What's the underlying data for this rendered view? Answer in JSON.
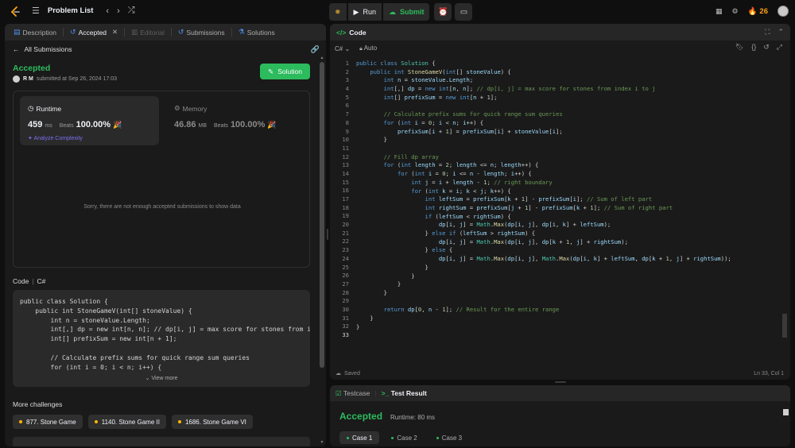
{
  "topbar": {
    "problem_list_label": "Problem List",
    "run_label": "Run",
    "submit_label": "Submit",
    "streak_count": "26"
  },
  "left_tabs": [
    {
      "label": "Description"
    },
    {
      "label": "Accepted"
    },
    {
      "label": "Editorial"
    },
    {
      "label": "Submissions"
    },
    {
      "label": "Solutions"
    }
  ],
  "submission": {
    "back_label": "All Submissions",
    "status": "Accepted",
    "user": "R M",
    "submitted_text": "submitted at Sep 26, 2024 17:03",
    "solution_button": "Solution",
    "runtime": {
      "title": "Runtime",
      "value": "459",
      "unit": "ms",
      "beats_label": "Beats",
      "beats_pct": "100.00%",
      "analyze_label": "Analyze Complexity"
    },
    "memory": {
      "title": "Memory",
      "value": "46.86",
      "unit": "MB",
      "beats_label": "Beats",
      "beats_pct": "100.00%"
    },
    "empty_note": "Sorry, there are not enough accepted submissions to show data",
    "code_label": "Code",
    "code_lang": "C#",
    "code_preview": "public class Solution {\n    public int StoneGameV(int[] stoneValue) {\n        int n = stoneValue.Length;\n        int[,] dp = new int[n, n]; // dp[i, j] = max score for stones from i\n        int[] prefixSum = new int[n + 1];\n\n        // Calculate prefix sums for quick range sum queries\n        for (int i = 0; i < n; i++) {",
    "view_more": "View more"
  },
  "more_challenges": {
    "title": "More challenges",
    "items": [
      {
        "label": "877. Stone Game"
      },
      {
        "label": "1140. Stone Game II"
      },
      {
        "label": "1686. Stone Game VI"
      }
    ]
  },
  "editor": {
    "title": "Code",
    "language": "C#",
    "mode": "Auto",
    "status_left": "Saved",
    "cursor_pos": "Ln 33, Col 1",
    "line_count": 33
  },
  "bottom": {
    "tabs": [
      {
        "label": "Testcase"
      },
      {
        "label": "Test Result"
      }
    ],
    "result": "Accepted",
    "runtime": "Runtime: 80 ms",
    "cases": [
      {
        "label": "Case 1"
      },
      {
        "label": "Case 2"
      },
      {
        "label": "Case 3"
      }
    ]
  },
  "colors": {
    "accent_green": "#2cbb5d",
    "streak_orange": "#ffa116",
    "analyze_purple": "#7c6ef2",
    "chip_dot": "#ffb800"
  }
}
